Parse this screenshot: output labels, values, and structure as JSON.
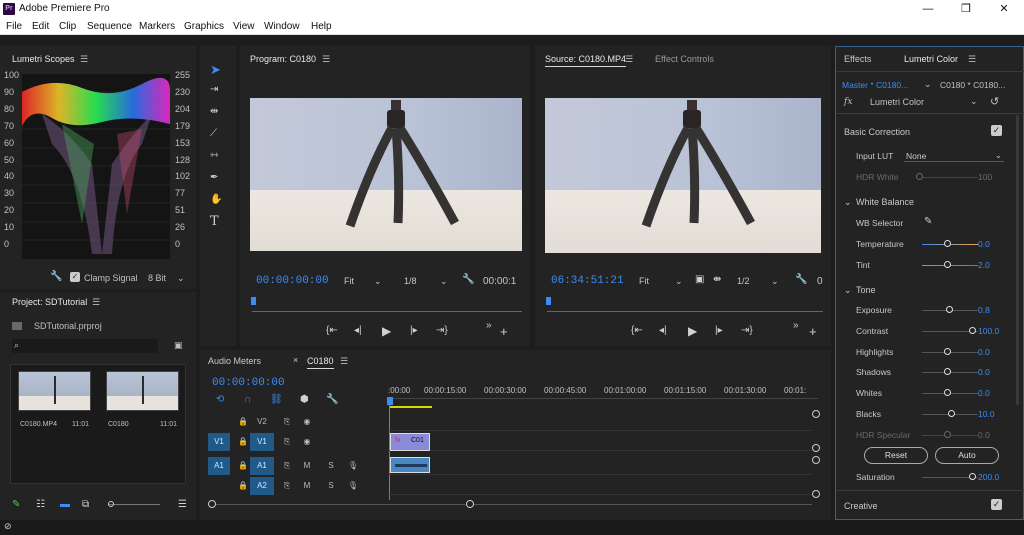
{
  "app": {
    "title": "Adobe Premiere Pro",
    "logo_text": "Pr"
  },
  "window_controls": {
    "minimize": "—",
    "maximize": "❐",
    "close": "✕"
  },
  "menu": [
    "File",
    "Edit",
    "Clip",
    "Sequence",
    "Markers",
    "Graphics",
    "View",
    "Window",
    "Help"
  ],
  "scopes": {
    "title": "Lumetri Scopes",
    "left_scale": [
      "100",
      "90",
      "80",
      "70",
      "60",
      "50",
      "40",
      "30",
      "20",
      "10",
      "0"
    ],
    "right_scale": [
      "255",
      "230",
      "204",
      "179",
      "153",
      "128",
      "102",
      "77",
      "51",
      "26",
      "0"
    ],
    "clamp_label": "Clamp Signal",
    "bit_depth": "8 Bit"
  },
  "program": {
    "title": "Program: C0180",
    "timecode": "00:00:00:00",
    "fit": "Fit",
    "resolution": "1/8",
    "duration": "00:00:1"
  },
  "source": {
    "title": "Source: C0180.MP4",
    "tab2": "Effect Controls",
    "timecode": "06:34:51:21",
    "fit": "Fit",
    "resolution": "1/2",
    "duration": "0"
  },
  "project": {
    "title": "Project: SDTutorial",
    "file": "SDTutorial.prproj",
    "items": [
      {
        "name": "C0180.MP4",
        "duration": "11:01"
      },
      {
        "name": "C0180",
        "duration": "11:01"
      }
    ]
  },
  "timeline": {
    "tab1": "Audio Meters",
    "tab2": "C0180",
    "timecode": "00:00:00:00",
    "ruler": [
      ":00:00",
      "00:00:15:00",
      "00:00:30:00",
      "00:00:45:00",
      "00:01:00:00",
      "00:01:15:00",
      "00:01:30:00",
      "00:01:"
    ],
    "tracks": [
      {
        "src": "",
        "name": "V2",
        "m": "",
        "s": ""
      },
      {
        "src": "V1",
        "name": "V1",
        "m": "",
        "s": ""
      },
      {
        "src": "A1",
        "name": "A1",
        "m": "M",
        "s": "S"
      },
      {
        "src": "",
        "name": "A2",
        "m": "M",
        "s": "S"
      }
    ],
    "clip_label": "C01"
  },
  "lumetri": {
    "tab1": "Effects",
    "tab2": "Lumetri Color",
    "master": "Master * C0180...",
    "clip": "C0180 * C0180...",
    "fx_label": "fx",
    "effect": "Lumetri Color",
    "basic": "Basic Correction",
    "input_lut_label": "Input LUT",
    "input_lut_value": "None",
    "hdr_white_label": "HDR White",
    "hdr_white_value": "100",
    "white_balance": "White Balance",
    "wb_selector": "WB Selector",
    "temperature": {
      "label": "Temperature",
      "value": "0.0"
    },
    "tint": {
      "label": "Tint",
      "value": "2.0"
    },
    "tone": "Tone",
    "exposure": {
      "label": "Exposure",
      "value": "0.8"
    },
    "contrast": {
      "label": "Contrast",
      "value": "100.0"
    },
    "highlights": {
      "label": "Highlights",
      "value": "0.0"
    },
    "shadows": {
      "label": "Shadows",
      "value": "0.0"
    },
    "whites": {
      "label": "Whites",
      "value": "0.0"
    },
    "blacks": {
      "label": "Blacks",
      "value": "10.0"
    },
    "hdr_specular": {
      "label": "HDR Specular",
      "value": "0.0"
    },
    "reset": "Reset",
    "auto": "Auto",
    "saturation": {
      "label": "Saturation",
      "value": "200.0"
    },
    "creative": "Creative"
  }
}
